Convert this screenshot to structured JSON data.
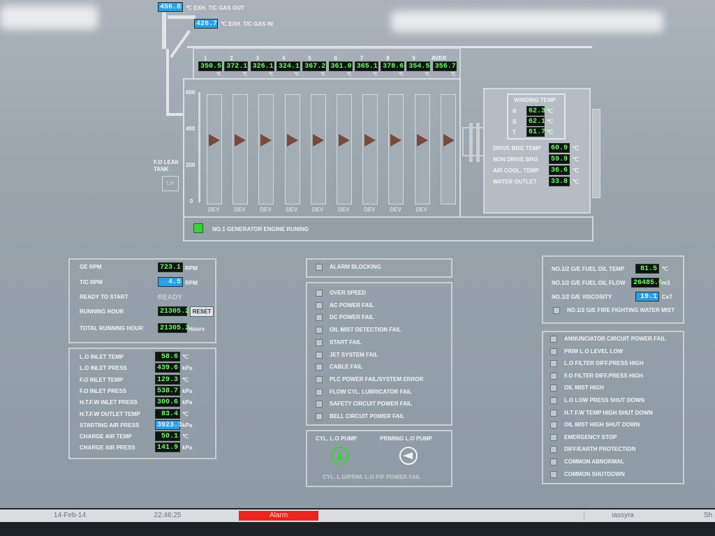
{
  "exhaust": {
    "gas_out_value": "456.8",
    "gas_out_label": "℃ EXH. T/C GAS OUT",
    "gas_in_value": "426.7",
    "gas_in_label": "℃ EXH. T/C GAS IN"
  },
  "cylinders": {
    "numbers": [
      "1",
      "2",
      "3",
      "4",
      "5",
      "6",
      "7",
      "8",
      "9",
      "AVER"
    ],
    "temps": [
      "350.5",
      "372.1",
      "326.1",
      "324.1",
      "367.2",
      "361.0",
      "365.1",
      "378.6",
      "354.5",
      "356.7"
    ],
    "unit": "℃",
    "scale": [
      "600",
      "400",
      "200",
      "0"
    ],
    "dev_label": "DEV"
  },
  "fo_leak": {
    "label": "F.O LEAK TANK",
    "lh": "LH"
  },
  "winding": {
    "title": "WINDING TEMP",
    "rows": [
      {
        "label": "R",
        "value": "62.3",
        "unit": "℃"
      },
      {
        "label": "S",
        "value": "62.1",
        "unit": "℃"
      },
      {
        "label": "T",
        "value": "61.7",
        "unit": "℃"
      }
    ],
    "bearings": [
      {
        "label": "DRIVE BRG TEMP",
        "value": "60.9",
        "unit": "℃"
      },
      {
        "label": "NON DRIVE BRG",
        "value": "59.9",
        "unit": "℃"
      },
      {
        "label": "AIR COOL. TEMP",
        "value": "36.6",
        "unit": "℃"
      },
      {
        "label": "WATER OUTLET",
        "value": "33.8",
        "unit": "℃"
      }
    ]
  },
  "engine_status": "NO.1 GENERATOR ENGINE RUNING",
  "rpm_panel": {
    "ge_rpm_label": "GE RPM",
    "ge_rpm": "723.1",
    "rpm_unit": "RPM",
    "tc_rpm_label": "T/C RPM",
    "tc_rpm": "4.5",
    "ready_label": "READY TO START",
    "ready_value": "READY",
    "running_label": "RUNNING HOUR",
    "running_value": "21305.2",
    "reset": "RESET",
    "total_label": "TOTAL RUNNING HOUR",
    "total_value": "21305.2",
    "hours_unit": "Hours"
  },
  "press_panel": [
    {
      "label": "L.O INLET TEMP",
      "value": "58.6",
      "unit": "℃",
      "blue": false
    },
    {
      "label": "L.O INLET PRESS",
      "value": "439.6",
      "unit": "kPa",
      "blue": false
    },
    {
      "label": "F.O INLET TEMP",
      "value": "129.3",
      "unit": "℃",
      "blue": false
    },
    {
      "label": "F.O INLET PRESS",
      "value": "538.7",
      "unit": "kPa",
      "blue": false
    },
    {
      "label": "H.T.F.W INLET PRESS",
      "value": "300.6",
      "unit": "kPa",
      "blue": false
    },
    {
      "label": "H.T.F.W OUTLET TEMP",
      "value": "83.4",
      "unit": "℃",
      "blue": false
    },
    {
      "label": "STARTING AIR PRESS",
      "value": "3923.3",
      "unit": "kPa",
      "blue": true
    },
    {
      "label": "CHARGE AIR TEMP",
      "value": "50.1",
      "unit": "℃",
      "blue": false
    },
    {
      "label": "CHARGE AIR PRESS",
      "value": "141.9",
      "unit": "kPa",
      "blue": false
    }
  ],
  "alarm_blocking": "ALARM BLOCKING",
  "alarms_mid": [
    "OVER SPEED",
    "AC POWER FAIL",
    "DC POWER FAIL",
    "OIL MIST DETECTION FAIL",
    "START FAIL",
    "JET SYSTEM FAIL",
    "CABLE FAIL",
    "PLC POWER FAIL/SYSTEM ERROR",
    "FLOW CYL. LUBRICATOR FAIL",
    "SAFETY CIRCUIT POWER FAIL",
    "BELL CIRCUIT POWER FAIL"
  ],
  "pumps": {
    "cyl_lo": "CYL. L.O PUMP",
    "priming": "PRIMING L.O PUMP",
    "fail": "CYL. L.O/PRIM. L.O P/P POWER FAIL"
  },
  "fuel_panel": {
    "rows": [
      {
        "label": "NO.1/2 G/E FUEL OIL TEMP",
        "value": "81.5",
        "unit": "℃",
        "blue": false
      },
      {
        "label": "NO.1/2 G/E FUEL OIL FLOW",
        "value": "26485.6",
        "unit": "m3",
        "blue": false
      },
      {
        "label": "NO.1/2 G/E VISCOSITY",
        "value": "19.1",
        "unit": "CsT",
        "blue": true
      }
    ],
    "mist": "NO.1/2 G/E FIRE FIGHTING WATER MIST"
  },
  "alarms_right": [
    "ANNUNCIATOR CIRCUIT POWER FAIL",
    "PRIM L.O LEVEL LOW",
    "L.O FILTER DIFF.PRESS HIGH",
    "F.O FILTER DIFF.PRESS HIGH",
    "OIL MIST HIGH",
    "L.O LOW PRESS SHUT DOWN",
    "H.T F.W TEMP HIGH SHUT DOWN",
    "OIL MIST HIGH SHUT DOWN",
    "EMERGENCY STOP",
    "DIFF/EARTH PROTECTION",
    "COMMON ABNORMAL",
    "COMMON SHUTDOWN"
  ],
  "taskbar": {
    "date": "14-Feb-14",
    "time": "22:46:25",
    "alarm": "Alarm",
    "user": "iassyra",
    "end": "Sh"
  },
  "colors": {
    "running_green": "#3bd13b",
    "value_green": "#6bff6b",
    "alarm_red": "#e8261f",
    "highlight_blue": "#2aa0e8"
  }
}
